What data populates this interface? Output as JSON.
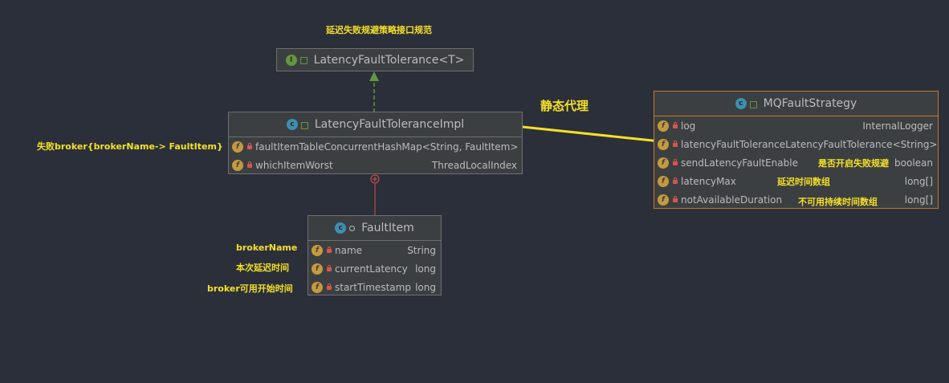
{
  "colors": {
    "background": "#2b2f3a",
    "annotation": "#f5e027",
    "selected_border": "#c27a26",
    "inheritance_arrow": "#62973f",
    "composition_line": "#d5574b"
  },
  "annotations": {
    "interface_note": "延迟失败规避策略接口规范",
    "proxy_note": "静态代理",
    "fault_table_note": "失败broker{brokerName-> FaultItem}",
    "broker_name_note": "brokerName",
    "current_latency_note": "本次延迟时间",
    "start_timestamp_note": "broker可用开始时间",
    "send_latency_note": "是否开启失败规避",
    "latency_max_note": "延迟时间数组",
    "not_available_note": "不可用持续时间数组"
  },
  "interface": {
    "icon": "interface-icon",
    "letter": "I",
    "name": "LatencyFaultTolerance<T>"
  },
  "impl": {
    "icon": "class-icon",
    "letter": "c",
    "name": "LatencyFaultToleranceImpl",
    "fields": [
      {
        "name": "faultItemTable",
        "type": "ConcurrentHashMap<String, FaultItem>"
      },
      {
        "name": "whichItemWorst",
        "type": "ThreadLocalIndex"
      }
    ]
  },
  "fault_item": {
    "icon": "class-icon",
    "letter": "c",
    "name": "FaultItem",
    "fields": [
      {
        "name": "name",
        "type": "String"
      },
      {
        "name": "currentLatency",
        "type": "long"
      },
      {
        "name": "startTimestamp",
        "type": "long"
      }
    ]
  },
  "strategy": {
    "icon": "class-icon",
    "letter": "c",
    "name": "MQFaultStrategy",
    "fields": [
      {
        "name": "log",
        "type": "InternalLogger"
      },
      {
        "name": "latencyFaultTolerance",
        "type": "LatencyFaultTolerance<String>"
      },
      {
        "name": "sendLatencyFaultEnable",
        "type": "boolean"
      },
      {
        "name": "latencyMax",
        "type": "long[]"
      },
      {
        "name": "notAvailableDuration",
        "type": "long[]"
      }
    ]
  },
  "field_icon_letter": "f"
}
